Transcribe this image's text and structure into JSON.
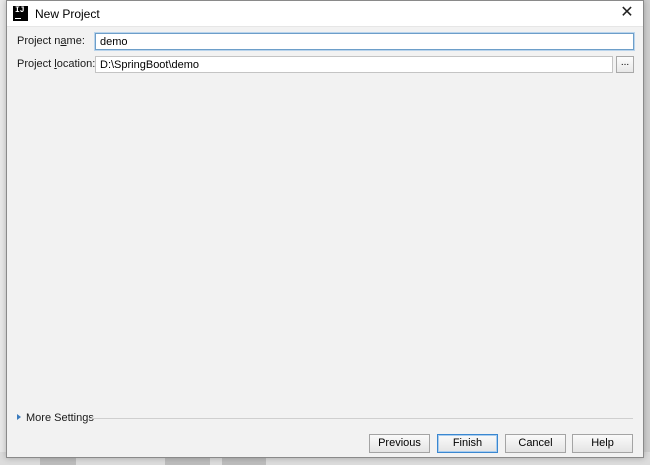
{
  "dialog": {
    "title": "New Project",
    "app_icon_text": "IJ"
  },
  "form": {
    "name_label_pre": "Project n",
    "name_label_mnemonic": "a",
    "name_label_post": "me:",
    "name_value": "demo",
    "location_label_pre": "Project ",
    "location_label_mnemonic": "l",
    "location_label_post": "ocation:",
    "location_value": "D:\\SpringBoot\\demo",
    "browse_label": "..."
  },
  "more_settings": {
    "label": "More Settings"
  },
  "buttons": {
    "previous": "Previous",
    "finish": "Finish",
    "cancel": "Cancel",
    "help": "Help"
  },
  "icons": {
    "close": "close-icon",
    "expand": "triangle-right-icon"
  },
  "colors": {
    "dialog_bg": "#f2f2f2",
    "focus_border": "#6d9ec9",
    "default_button_border": "#3a87d0",
    "expander": "#3a7bbd"
  }
}
